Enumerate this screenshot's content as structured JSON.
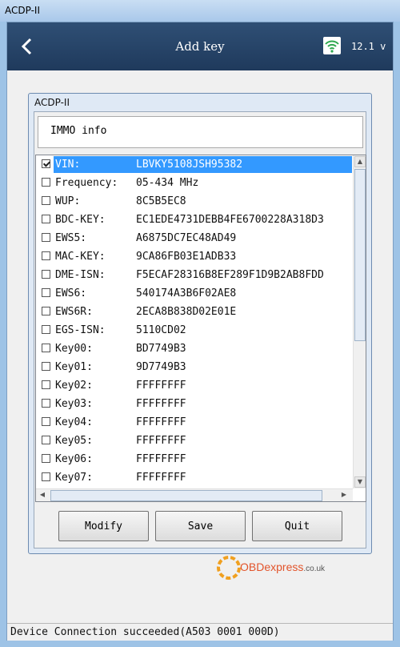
{
  "window": {
    "title": "ACDP-II"
  },
  "appbar": {
    "title": "Add key",
    "voltage": "12.1 v",
    "icons": [
      "back-arrow-icon",
      "wifi-icon"
    ]
  },
  "dialog": {
    "title": "ACDP-II",
    "info_label": "IMMO info",
    "rows": [
      {
        "label": "VIN:",
        "value": "LBVKY5108JSH95382",
        "checked": true,
        "selected": true
      },
      {
        "label": "Frequency:",
        "value": "05-434 MHz",
        "checked": false
      },
      {
        "label": "WUP:",
        "value": "8C5B5EC8",
        "checked": false
      },
      {
        "label": "BDC-KEY:",
        "value": "EC1EDE4731DEBB4FE6700228A318D3",
        "checked": false
      },
      {
        "label": "EWS5:",
        "value": "A6875DC7EC48AD49",
        "checked": false
      },
      {
        "label": "MAC-KEY:",
        "value": "9CA86FB03E1ADB33",
        "checked": false
      },
      {
        "label": "DME-ISN:",
        "value": "F5ECAF28316B8EF289F1D9B2AB8FDD",
        "checked": false
      },
      {
        "label": "EWS6:",
        "value": "540174A3B6F02AE8",
        "checked": false
      },
      {
        "label": "EWS6R:",
        "value": "2ECA8B838D02E01E",
        "checked": false
      },
      {
        "label": "EGS-ISN:",
        "value": "5110CD02",
        "checked": false
      },
      {
        "label": "Key00:",
        "value": "BD7749B3",
        "checked": false
      },
      {
        "label": "Key01:",
        "value": "9D7749B3",
        "checked": false
      },
      {
        "label": "Key02:",
        "value": "FFFFFFFF",
        "checked": false
      },
      {
        "label": "Key03:",
        "value": "FFFFFFFF",
        "checked": false
      },
      {
        "label": "Key04:",
        "value": "FFFFFFFF",
        "checked": false
      },
      {
        "label": "Key05:",
        "value": "FFFFFFFF",
        "checked": false
      },
      {
        "label": "Key06:",
        "value": "FFFFFFFF",
        "checked": false
      },
      {
        "label": "Key07:",
        "value": "FFFFFFFF",
        "checked": false
      }
    ],
    "buttons": {
      "modify": "Modify",
      "save": "Save",
      "quit": "Quit"
    }
  },
  "watermark": {
    "brand": "OBDexpress",
    "suffix": ".co.uk"
  },
  "status_bar": {
    "text": "Device Connection succeeded(A503 0001 000D)"
  },
  "colors": {
    "selection": "#3399ff",
    "appbar": "#2a4a6e"
  }
}
